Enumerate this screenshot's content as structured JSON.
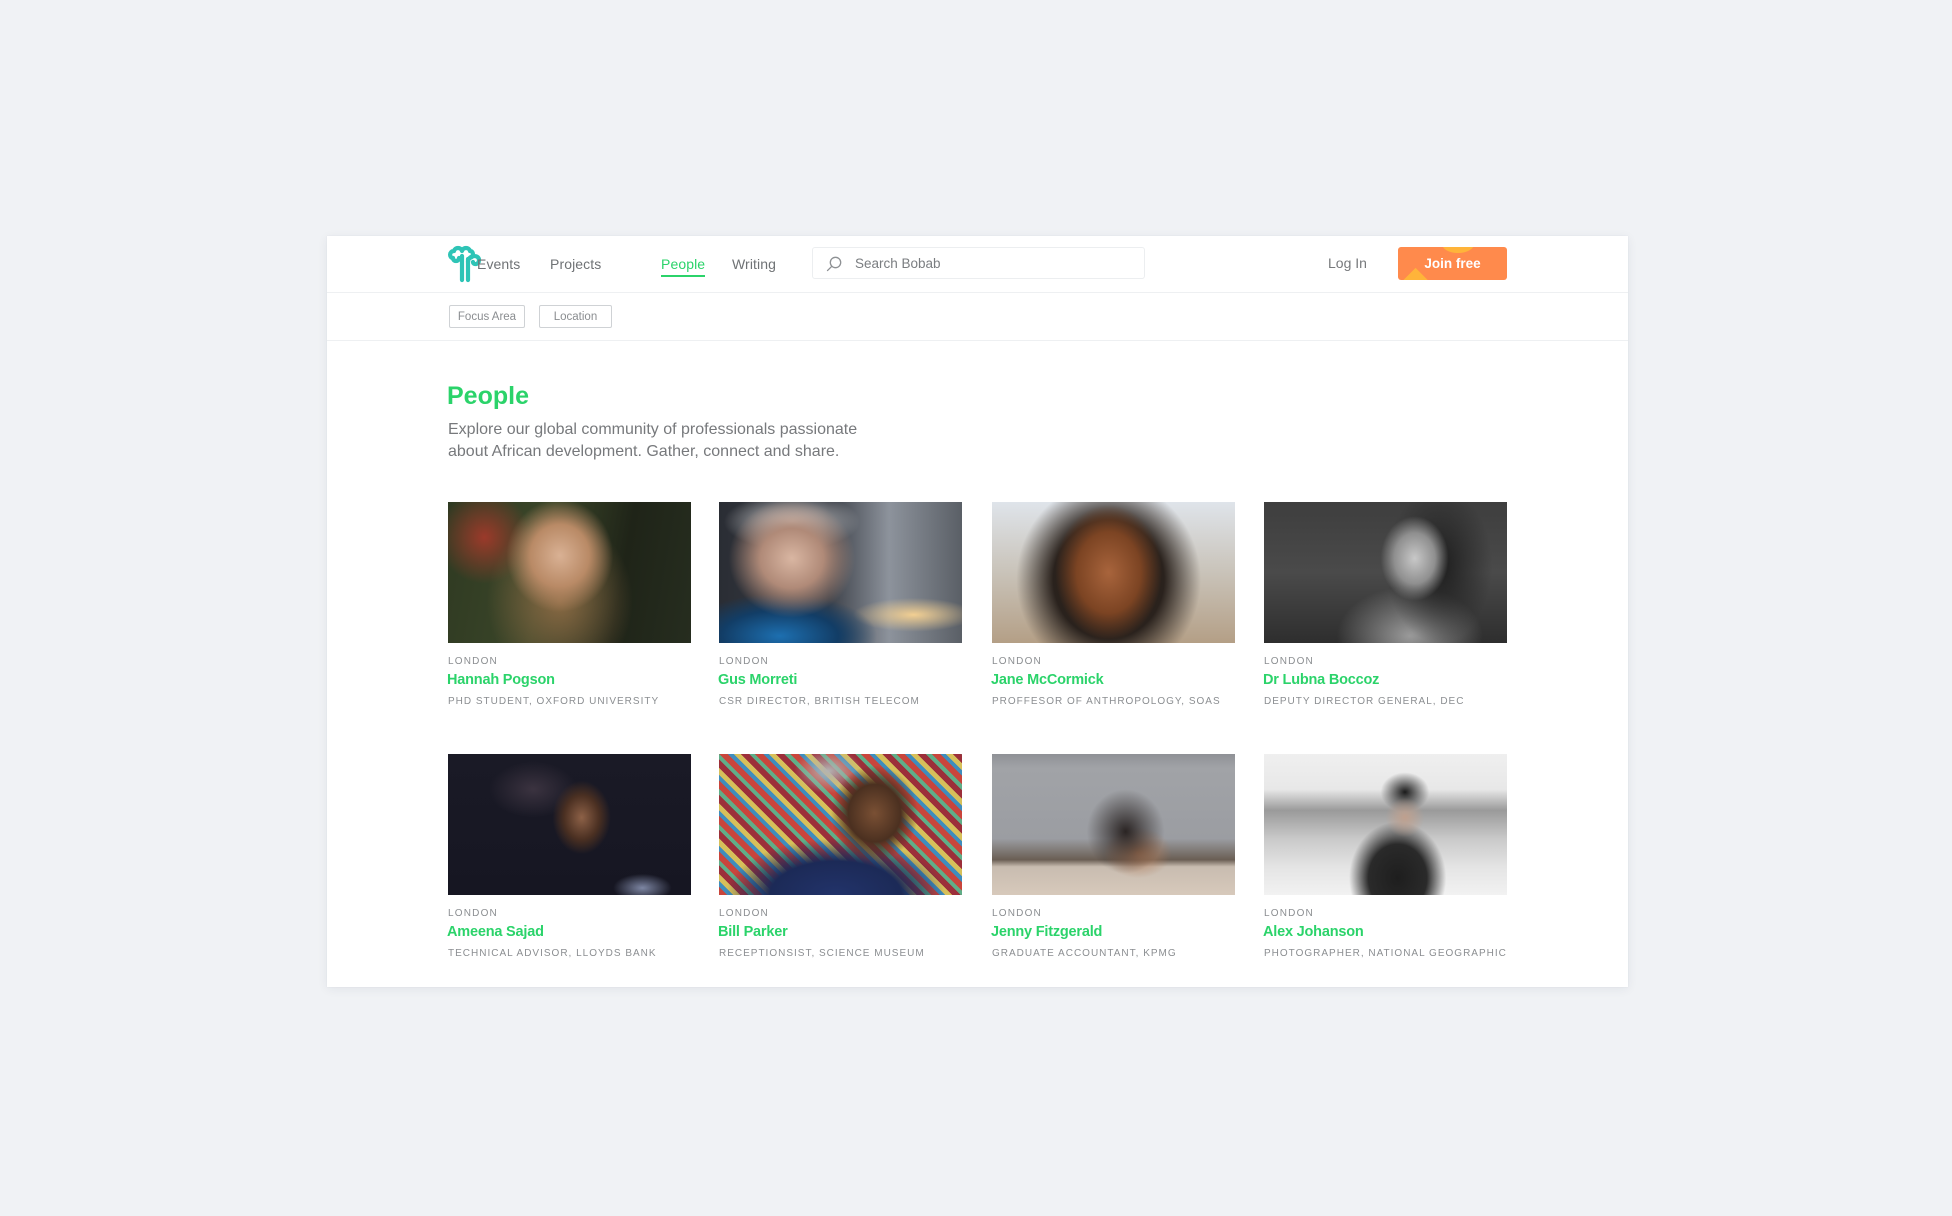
{
  "nav": {
    "logo_alt": "Bobab logo",
    "links": [
      {
        "label": "Events",
        "active": false
      },
      {
        "label": "Projects",
        "active": false
      },
      {
        "label": "People",
        "active": true
      },
      {
        "label": "Writing",
        "active": false
      }
    ],
    "search_placeholder": "Search Bobab",
    "login_label": "Log In",
    "join_label": "Join free"
  },
  "filters": [
    {
      "label": "Focus Area"
    },
    {
      "label": "Location"
    }
  ],
  "page": {
    "title": "People",
    "intro_line1": "Explore our global community of professionals passionate",
    "intro_line2": "about African development. Gather, connect and share."
  },
  "people": [
    {
      "location": "LONDON",
      "name": "Hannah Pogson",
      "role": "PHD STUDENT, OXFORD UNIVERSITY"
    },
    {
      "location": "LONDON",
      "name": "Gus Morreti",
      "role": "CSR DIRECTOR, BRITISH TELECOM"
    },
    {
      "location": "LONDON",
      "name": "Jane McCormick",
      "role": "PROFFESOR OF ANTHROPOLOGY, SOAS"
    },
    {
      "location": "LONDON",
      "name": "Dr Lubna Boccoz",
      "role": "DEPUTY DIRECTOR GENERAL, DEC"
    },
    {
      "location": "LONDON",
      "name": "Ameena Sajad",
      "role": "TECHNICAL ADVISOR, LLOYDS BANK"
    },
    {
      "location": "LONDON",
      "name": "Bill Parker",
      "role": "RECEPTIONSIST, SCIENCE MUSEUM"
    },
    {
      "location": "LONDON",
      "name": "Jenny Fitzgerald",
      "role": "GRADUATE ACCOUNTANT, KPMG"
    },
    {
      "location": "LONDON",
      "name": "Alex Johanson",
      "role": "PHOTOGRAPHER, NATIONAL GEOGRAPHIC"
    }
  ],
  "colors": {
    "accent_green": "#2bd36a",
    "logo_teal": "#2ec4b6",
    "cta_orange": "#ff8a4c",
    "page_bg": "#f0f2f5"
  }
}
